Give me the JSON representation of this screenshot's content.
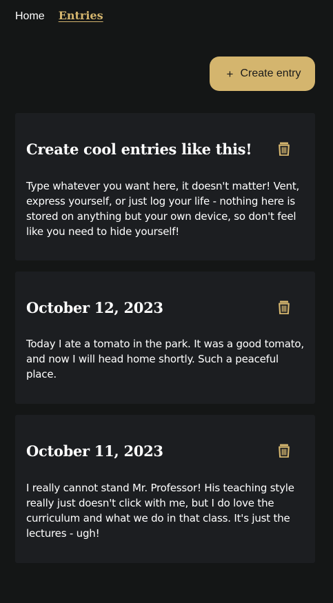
{
  "nav": {
    "home_label": "Home",
    "entries_label": "Entries"
  },
  "actions": {
    "create_label": "Create entry",
    "create_icon": "plus-icon"
  },
  "colors": {
    "background": "#141616",
    "card": "#1c1e21",
    "accent": "#d4b56e"
  },
  "entries": [
    {
      "title": "Create cool entries like this!",
      "body": "Type whatever you want here, it doesn't matter! Vent, express yourself, or just log your life - nothing here is stored on anything but your own device, so don't feel like you need to hide yourself!"
    },
    {
      "title": "October 12, 2023",
      "body": "Today I ate a tomato in the park. It was a good tomato, and now I will head home shortly. Such a peaceful place."
    },
    {
      "title": "October 11, 2023",
      "body": "I really cannot stand Mr. Professor! His teaching style really just doesn't click with me, but I do love the curriculum and what we do in that class. It's just the lectures - ugh!"
    }
  ]
}
